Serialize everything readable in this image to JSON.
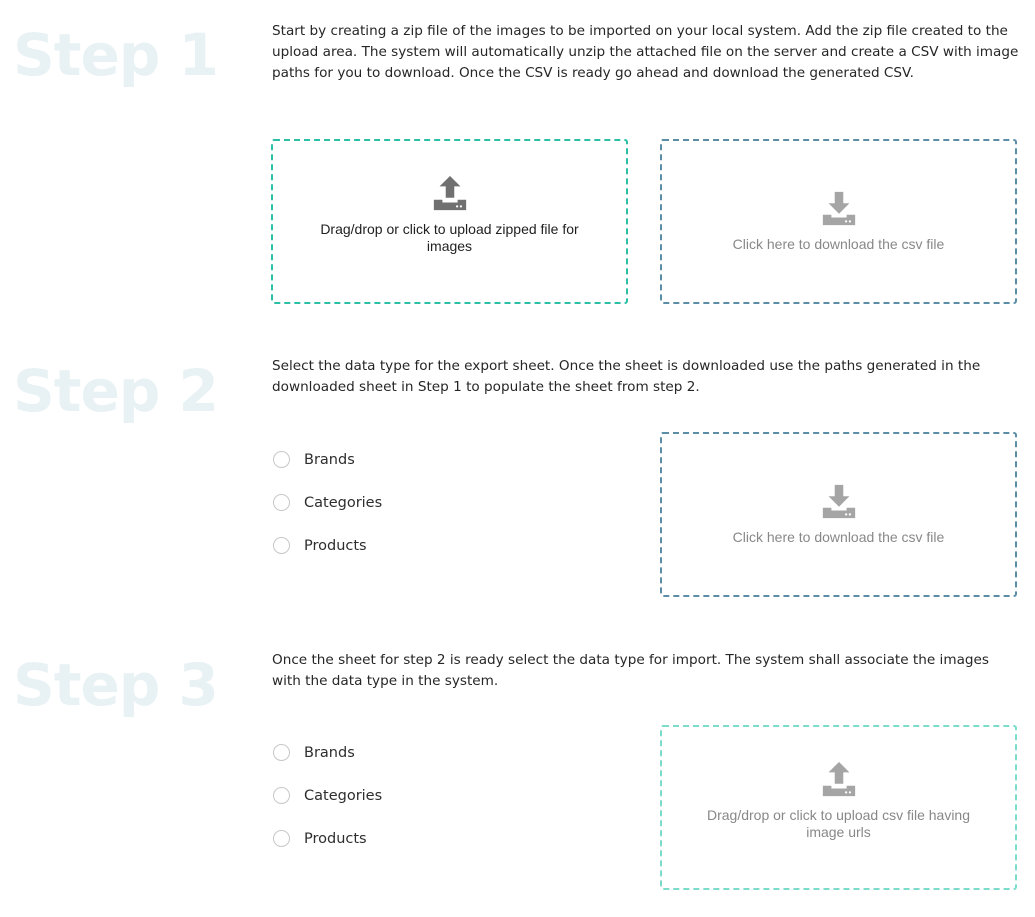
{
  "step1": {
    "title": "Step 1",
    "description": "Start by creating a zip file of the images to be imported on your local system. Add the zip file created to the upload area. The system will automatically unzip the attached file on the server and create a CSV with image paths for you to download. Once the CSV is ready go ahead and download the generated CSV.",
    "upload_label": "Drag/drop or click to upload zipped file for images",
    "download_label": "Click here to download the csv file"
  },
  "step2": {
    "title": "Step 2",
    "description": "Select the data type for the export sheet. Once the sheet is downloaded use the paths generated in the downloaded sheet in Step 1 to populate the sheet from step 2.",
    "options": [
      "Brands",
      "Categories",
      "Products"
    ],
    "download_label": "Click here to download the csv file"
  },
  "step3": {
    "title": "Step 3",
    "description": "Once the sheet for step 2 is ready select the data type for import. The system shall associate the images with the data type in the system.",
    "options": [
      "Brands",
      "Categories",
      "Products"
    ],
    "upload_label": "Drag/drop or click to upload csv file having image urls"
  },
  "colors": {
    "upload_border": "#2bbfa6",
    "download_border": "#5b8ea6",
    "step_title": "#e8f1f4",
    "icon_dark": "#707070",
    "icon_light": "#a5a5a5"
  },
  "icons": {
    "upload": "upload-tray-icon",
    "download": "download-tray-icon"
  }
}
